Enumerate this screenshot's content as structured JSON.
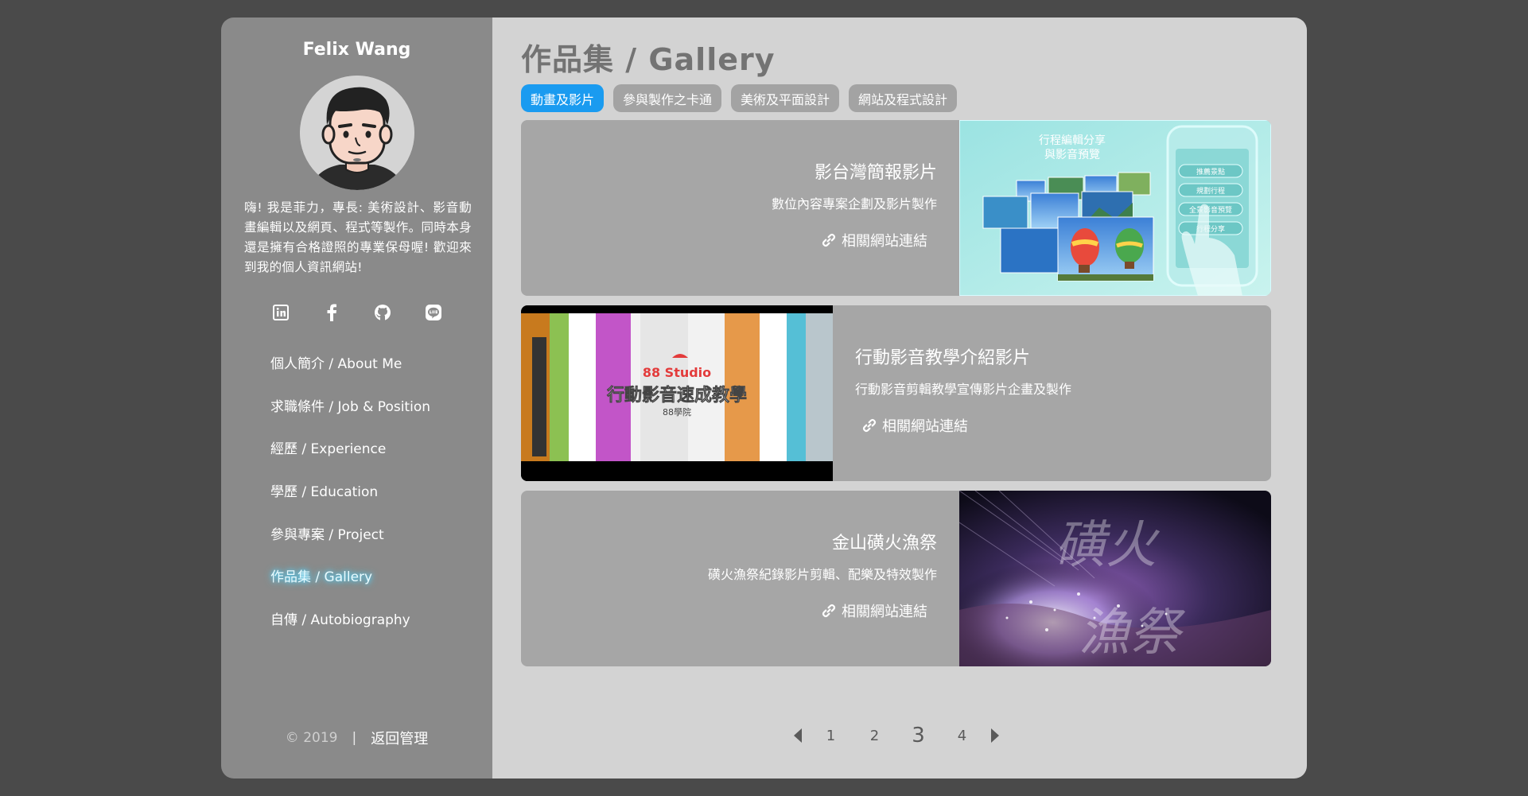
{
  "sidebar": {
    "name": "Felix Wang",
    "bio": "嗨! 我是菲力，專長: 美術設計、影音動畫編輯以及網頁、程式等製作。同時本身還是擁有合格證照的專業保母喔! 歡迎來到我的個人資訊網站!",
    "socials": [
      "linkedin-icon",
      "facebook-icon",
      "github-icon",
      "line-icon"
    ],
    "nav": [
      {
        "label": "個人簡介 / About Me"
      },
      {
        "label": "求職條件 / Job & Position"
      },
      {
        "label": "經歷 / Experience"
      },
      {
        "label": "學歷 / Education"
      },
      {
        "label": "參與專案 / Project"
      },
      {
        "label": "作品集 / Gallery",
        "active": true
      },
      {
        "label": "自傳 / Autobiography"
      }
    ],
    "footer": {
      "copyright": "© 2019",
      "separator": "|",
      "back": "返回管理"
    }
  },
  "main": {
    "title": "作品集 / Gallery",
    "tabs": [
      {
        "label": "動畫及影片",
        "active": true
      },
      {
        "label": "參與製作之卡通"
      },
      {
        "label": "美術及平面設計"
      },
      {
        "label": "網站及程式設計"
      }
    ],
    "cards": [
      {
        "title": "影台灣簡報影片",
        "desc": "數位內容專案企劃及影片製作",
        "link": "相關網站連結",
        "image_text": [
          "行程編輯分享",
          "與影音預覽",
          "推薦景點",
          "規劃行程",
          "全景影音預覽",
          "行程分享"
        ]
      },
      {
        "title": "行動影音教學介紹影片",
        "desc": "行動影音剪輯教學宣傳影片企畫及製作",
        "link": "相關網站連結",
        "image_text": [
          "88 Studio",
          "行動影音速成教學",
          "88學院"
        ]
      },
      {
        "title": "金山磺火漁祭",
        "desc": "磺火漁祭紀錄影片剪輯、配樂及特效製作",
        "link": "相關網站連結",
        "image_text": [
          "磺火",
          "漁祭"
        ]
      }
    ],
    "pager": {
      "pages": [
        "1",
        "2",
        "3",
        "4"
      ],
      "current": "3"
    }
  },
  "colors": {
    "accent": "#1a9bf0",
    "sidebar_bg": "#8a8a8a",
    "main_bg": "#d3d3d3",
    "card_bg": "#a6a6a6",
    "page_bg": "#4a4a4a",
    "nav_glow": "#4fd4ff"
  }
}
